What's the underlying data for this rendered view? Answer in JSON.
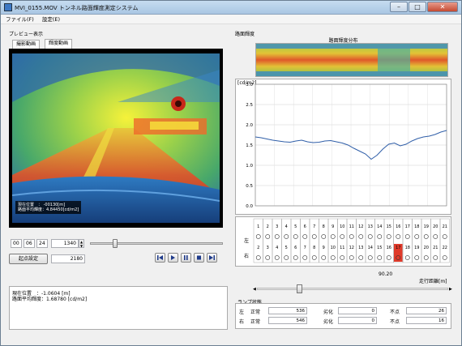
{
  "window": {
    "title": "MVI_0155.MOV トンネル路面輝度測定システム"
  },
  "menu": [
    {
      "label": "ファイル(F)"
    },
    {
      "label": "設定(E)"
    }
  ],
  "preview": {
    "group_label": "プレビュー表示",
    "tabs": [
      {
        "label": "撮影動画"
      },
      {
        "label": "輝度動画"
      }
    ],
    "overlay": {
      "line1": "現在位置　：   -00130[m]",
      "line2": "路面平均輝度：4.84450[cd/m2]"
    }
  },
  "controls": {
    "time_h": "00",
    "time_m": "06",
    "time_s": "24",
    "frame": "1340",
    "origin_button": "起点設定",
    "origin_value": "2180",
    "seek_level": 0.18
  },
  "info": {
    "line1": "現在位置　：-1.0604 [m]",
    "line2": "路面平均輝度：1.68780 [cd/m2]"
  },
  "luminance": {
    "group_label": "路面輝度",
    "dist_title": "路面輝度分布",
    "unit_label": "[cd/m2]"
  },
  "chart_data": {
    "type": "line",
    "ylabel": "[cd/m2]",
    "ylim": [
      0,
      3.0
    ],
    "yticks": [
      "3.0",
      "2.5",
      "2.0",
      "1.5",
      "1.0",
      "0.5",
      "0.0"
    ],
    "grid": true,
    "series": [
      {
        "values": [
          1.7,
          1.68,
          1.65,
          1.62,
          1.6,
          1.58,
          1.57,
          1.6,
          1.62,
          1.58,
          1.56,
          1.57,
          1.6,
          1.61,
          1.58,
          1.55,
          1.5,
          1.42,
          1.35,
          1.28,
          1.15,
          1.25,
          1.4,
          1.52,
          1.55,
          1.48,
          1.52,
          1.6,
          1.66,
          1.7,
          1.72,
          1.76,
          1.82,
          1.86
        ]
      }
    ]
  },
  "lamps": {
    "left_label": "左",
    "right_label": "右",
    "numbers_top": [
      "1",
      "2",
      "3",
      "4",
      "5",
      "6",
      "7",
      "8",
      "9",
      "10",
      "11",
      "12",
      "13",
      "14",
      "15",
      "16",
      "17",
      "18",
      "19",
      "20",
      "21"
    ],
    "numbers_bottom": [
      "2",
      "3",
      "4",
      "5",
      "6",
      "7",
      "8",
      "9",
      "10",
      "11",
      "12",
      "13",
      "14",
      "15",
      "16",
      "17",
      "18",
      "19",
      "20",
      "21",
      "22"
    ],
    "fault_index": 15,
    "distance_value": "90.20",
    "distance_label": "走行距離[m]",
    "scroll_level": 0.2
  },
  "lamp_status": {
    "group_label": "ランプ状態",
    "left_label": "左",
    "right_label": "右",
    "normal_label": "正常",
    "degraded_label": "劣化",
    "failed_label": "不点",
    "left_normal": "536",
    "left_degraded": "0",
    "left_failed": "26",
    "right_normal": "546",
    "right_degraded": "0",
    "right_failed": "16"
  }
}
